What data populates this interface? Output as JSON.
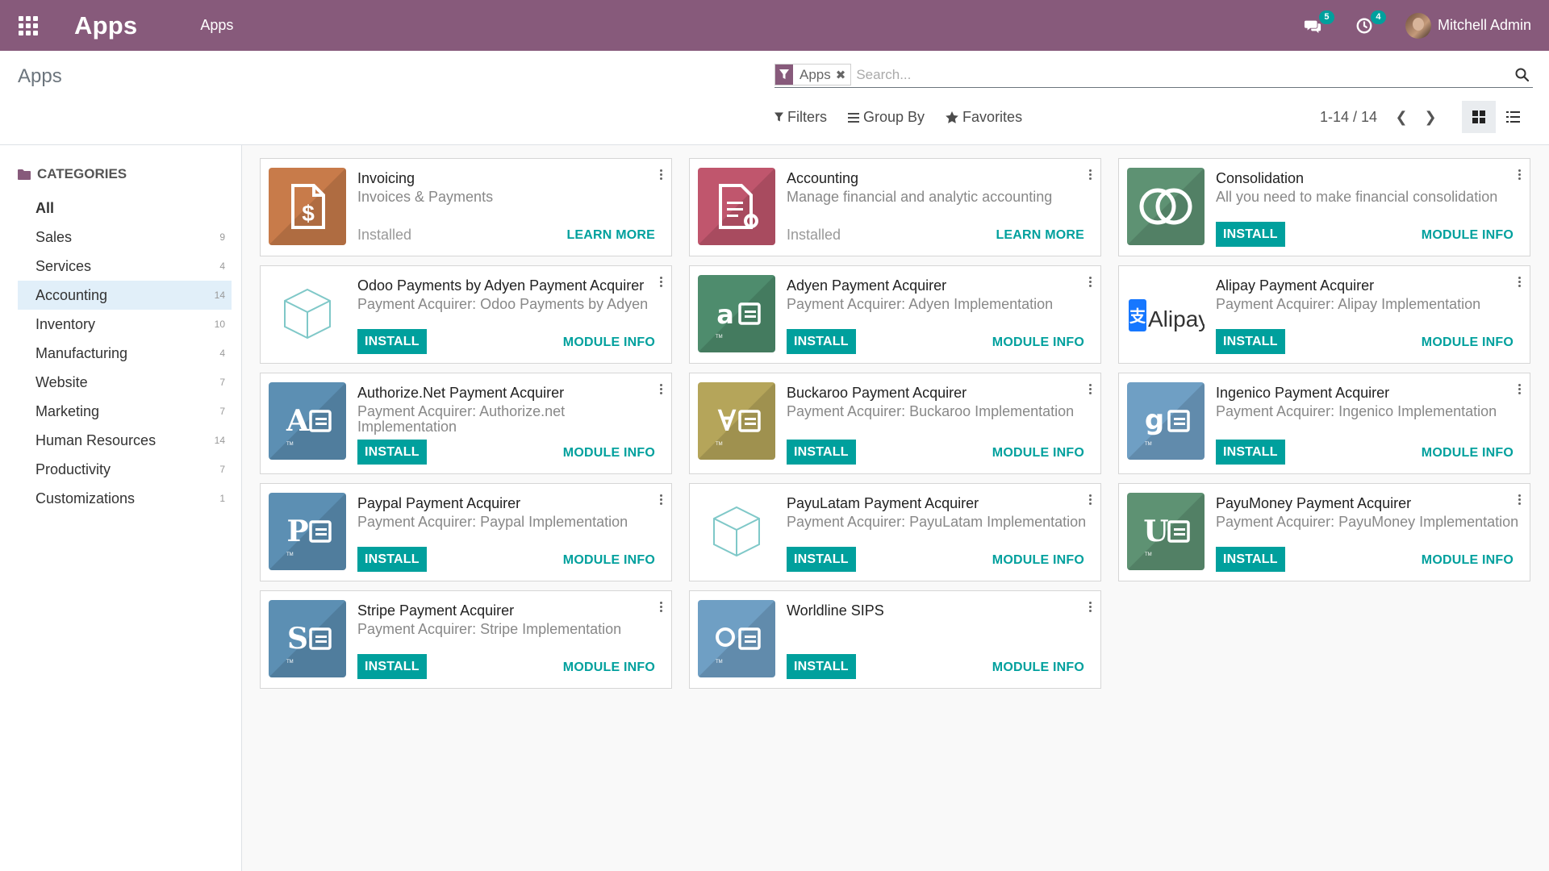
{
  "navbar": {
    "brand": "Apps",
    "menu": [
      "Apps"
    ],
    "messages_count": "5",
    "activities_count": "4",
    "user_name": "Mitchell Admin",
    "color": "#875a7b"
  },
  "control": {
    "breadcrumb": "Apps",
    "search": {
      "facet_label": "Apps",
      "placeholder": "Search..."
    },
    "filters_label": "Filters",
    "groupby_label": "Group By",
    "favorites_label": "Favorites",
    "pager": "1-14 / 14"
  },
  "sidebar": {
    "header": "CATEGORIES",
    "items": [
      {
        "label": "All",
        "count": ""
      },
      {
        "label": "Sales",
        "count": "9"
      },
      {
        "label": "Services",
        "count": "4"
      },
      {
        "label": "Accounting",
        "count": "14"
      },
      {
        "label": "Inventory",
        "count": "10"
      },
      {
        "label": "Manufacturing",
        "count": "4"
      },
      {
        "label": "Website",
        "count": "7"
      },
      {
        "label": "Marketing",
        "count": "7"
      },
      {
        "label": "Human Resources",
        "count": "14"
      },
      {
        "label": "Productivity",
        "count": "7"
      },
      {
        "label": "Customizations",
        "count": "1"
      }
    ]
  },
  "apps": [
    {
      "title": "Invoicing",
      "summary": "Invoices & Payments",
      "status": "Installed",
      "action": "",
      "link": "LEARN MORE",
      "icon": "invoice-icon",
      "color": "#c87b4a"
    },
    {
      "title": "Accounting",
      "summary": "Manage financial and analytic accounting",
      "status": "Installed",
      "action": "",
      "link": "LEARN MORE",
      "icon": "accounting-icon",
      "color": "#c0566d"
    },
    {
      "title": "Consolidation",
      "summary": "All you need to make financial consolidation",
      "status": "",
      "action": "INSTALL",
      "link": "MODULE INFO",
      "icon": "consolidation-icon",
      "color": "#5e9273"
    },
    {
      "title": "Odoo Payments by Adyen Payment Acquirer",
      "summary": "Payment Acquirer: Odoo Payments by Adyen",
      "status": "",
      "action": "INSTALL",
      "link": "MODULE INFO",
      "icon": "cube-icon",
      "color": "#ffffff"
    },
    {
      "title": "Adyen Payment Acquirer",
      "summary": "Payment Acquirer: Adyen Implementation",
      "status": "",
      "action": "INSTALL",
      "link": "MODULE INFO",
      "icon": "adyen-icon",
      "color": "#4e8c6d"
    },
    {
      "title": "Alipay Payment Acquirer",
      "summary": "Payment Acquirer: Alipay Implementation",
      "status": "",
      "action": "INSTALL",
      "link": "MODULE INFO",
      "icon": "alipay-icon",
      "color": "#ffffff"
    },
    {
      "title": "Authorize.Net Payment Acquirer",
      "summary": "Payment Acquirer: Authorize.net Implementation",
      "status": "",
      "action": "INSTALL",
      "link": "MODULE INFO",
      "icon": "authorize-icon",
      "color": "#5c8fb3"
    },
    {
      "title": "Buckaroo Payment Acquirer",
      "summary": "Payment Acquirer: Buckaroo Implementation",
      "status": "",
      "action": "INSTALL",
      "link": "MODULE INFO",
      "icon": "buckaroo-icon",
      "color": "#b5a55a"
    },
    {
      "title": "Ingenico Payment Acquirer",
      "summary": "Payment Acquirer: Ingenico Implementation",
      "status": "",
      "action": "INSTALL",
      "link": "MODULE INFO",
      "icon": "ingenico-icon",
      "color": "#6f9fc4"
    },
    {
      "title": "Paypal Payment Acquirer",
      "summary": "Payment Acquirer: Paypal Implementation",
      "status": "",
      "action": "INSTALL",
      "link": "MODULE INFO",
      "icon": "paypal-icon",
      "color": "#5c8fb3"
    },
    {
      "title": "PayuLatam Payment Acquirer",
      "summary": "Payment Acquirer: PayuLatam Implementation",
      "status": "",
      "action": "INSTALL",
      "link": "MODULE INFO",
      "icon": "cube-icon",
      "color": "#ffffff"
    },
    {
      "title": "PayuMoney Payment Acquirer",
      "summary": "Payment Acquirer: PayuMoney Implementation",
      "status": "",
      "action": "INSTALL",
      "link": "MODULE INFO",
      "icon": "payumoney-icon",
      "color": "#5e9273"
    },
    {
      "title": "Stripe Payment Acquirer",
      "summary": "Payment Acquirer: Stripe Implementation",
      "status": "",
      "action": "INSTALL",
      "link": "MODULE INFO",
      "icon": "stripe-icon",
      "color": "#5c8fb3"
    },
    {
      "title": "Worldline SIPS",
      "summary": "",
      "status": "",
      "action": "INSTALL",
      "link": "MODULE INFO",
      "icon": "worldline-icon",
      "color": "#6f9fc4"
    }
  ]
}
